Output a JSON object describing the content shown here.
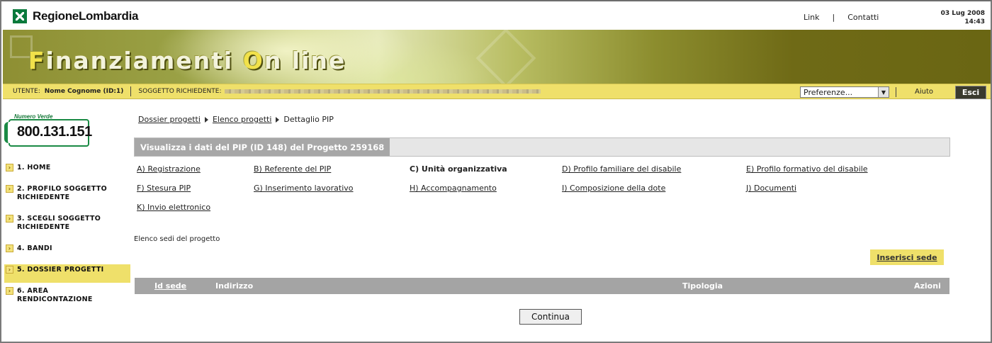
{
  "header": {
    "logo_text": "RegioneLombardia",
    "links": [
      "Link",
      "|",
      "Contatti"
    ],
    "date": "03 Lug 2008",
    "time": "14:43"
  },
  "banner": {
    "title_parts": [
      "F",
      "inanziamenti ",
      "O",
      "n line"
    ]
  },
  "userbar": {
    "utente_label": "UTENTE:",
    "utente_value": "Nome Cognome (ID:1)",
    "soggetto_label": "SOGGETTO RICHIEDENTE:",
    "preferences_value": "Preferenze...",
    "aiuto": "Aiuto",
    "esci": "Esci"
  },
  "sidebar": {
    "numero_verde_label": "Numero Verde",
    "numero_verde": "800.131.151",
    "items": [
      {
        "label": "1. HOME",
        "active": false
      },
      {
        "label": "2. PROFILO SOGGETTO RICHIEDENTE",
        "active": false
      },
      {
        "label": "3. SCEGLI SOGGETTO RICHIEDENTE",
        "active": false
      },
      {
        "label": "4. BANDI",
        "active": false
      },
      {
        "label": "5. DOSSIER PROGETTI",
        "active": true
      },
      {
        "label": "6. AREA RENDICONTAZIONE",
        "active": false
      }
    ]
  },
  "breadcrumb": [
    "Dossier progetti",
    "Elenco progetti",
    "Dettaglio PIP"
  ],
  "panel": {
    "title": "Visualizza i dati del PIP (ID 148) del Progetto 259168"
  },
  "sections": [
    {
      "label": "A) Registrazione",
      "current": false
    },
    {
      "label": "B) Referente del PIP",
      "current": false
    },
    {
      "label": "C) Unità organizzativa",
      "current": true
    },
    {
      "label": "D) Profilo familiare del disabile",
      "current": false
    },
    {
      "label": "E) Profilo formativo del disabile",
      "current": false
    },
    {
      "label": "F) Stesura PIP",
      "current": false
    },
    {
      "label": "G) Inserimento lavorativo",
      "current": false
    },
    {
      "label": "H) Accompagnamento",
      "current": false
    },
    {
      "label": "I) Composizione della dote",
      "current": false
    },
    {
      "label": "J) Documenti",
      "current": false
    },
    {
      "label": "K) Invio elettronico",
      "current": false
    }
  ],
  "sedi": {
    "label": "Elenco sedi del progetto",
    "insert_button": "Inserisci sede",
    "columns": [
      "Id sede",
      "Indirizzo",
      "Tipologia",
      "Azioni"
    ],
    "rows": []
  },
  "continua_button": "Continua"
}
